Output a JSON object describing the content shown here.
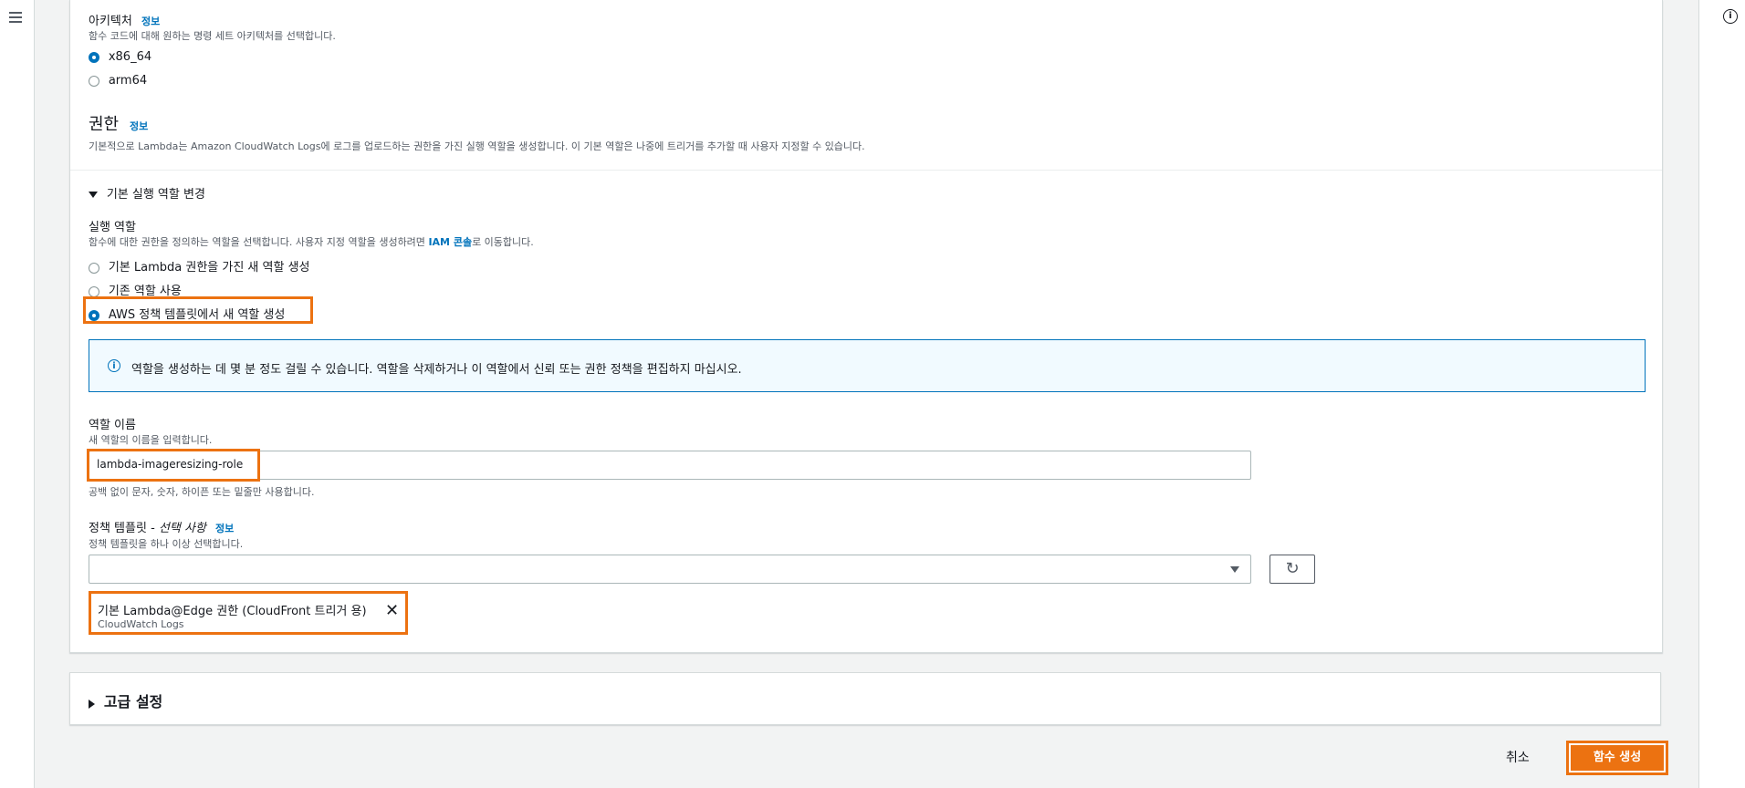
{
  "architecture": {
    "label": "아키텍처",
    "info_link": "정보",
    "description": "함수 코드에 대해 원하는 명령 세트 아키텍처를 선택합니다.",
    "options": [
      {
        "label": "x86_64",
        "selected": true
      },
      {
        "label": "arm64",
        "selected": false
      }
    ]
  },
  "permissions": {
    "heading": "권한",
    "info_link": "정보",
    "description": "기본적으로 Lambda는 Amazon CloudWatch Logs에 로그를 업로드하는 권한을 가진 실행 역할을 생성합니다. 이 기본 역할은 나중에 트리거를 추가할 때 사용자 지정할 수 있습니다."
  },
  "default_role": {
    "toggle_label": "기본 실행 역할 변경",
    "expanded": true
  },
  "execution_role": {
    "label": "실행 역할",
    "description_prefix": "함수에 대한 권한을 정의하는 역할을 선택합니다. 사용자 지정 역할을 생성하려면",
    "iam_link": "IAM 콘솔",
    "description_suffix": "로 이동합니다.",
    "options": [
      {
        "label": "기본 Lambda 권한을 가진 새 역할 생성",
        "selected": false
      },
      {
        "label": "기존 역할 사용",
        "selected": false
      },
      {
        "label": "AWS 정책 템플릿에서 새 역할 생성",
        "selected": true
      }
    ]
  },
  "info_alert": {
    "icon": "info-icon",
    "text": "역할을 생성하는 데 몇 분 정도 걸릴 수 있습니다. 역할을 삭제하거나 이 역할에서 신뢰 또는 권한 정책을 편집하지 마십시오."
  },
  "role_name": {
    "label": "역할 이름",
    "description": "새 역할의 이름을 입력합니다.",
    "value": "lambda-imageresizing-role",
    "constraint": "공백 없이 문자, 숫자, 하이픈 또는 밑줄만 사용합니다."
  },
  "policy_templates": {
    "label": "정책 템플릿 -",
    "optional": "선택 사항",
    "info_link": "정보",
    "description": "정책 템플릿을 하나 이상 선택합니다.",
    "selected_value": "",
    "refresh_icon": "refresh-icon",
    "token": {
      "label": "기본 Lambda@Edge 권한 (CloudFront 트리거 용)",
      "sublabel": "CloudWatch Logs"
    }
  },
  "advanced": {
    "label": "고급 설정",
    "expanded": false
  },
  "footer": {
    "cancel_label": "취소",
    "create_label": "함수 생성"
  },
  "colors": {
    "accent": "#0073bb",
    "primary_button": "#ec7211",
    "highlight": "#ec7211"
  }
}
